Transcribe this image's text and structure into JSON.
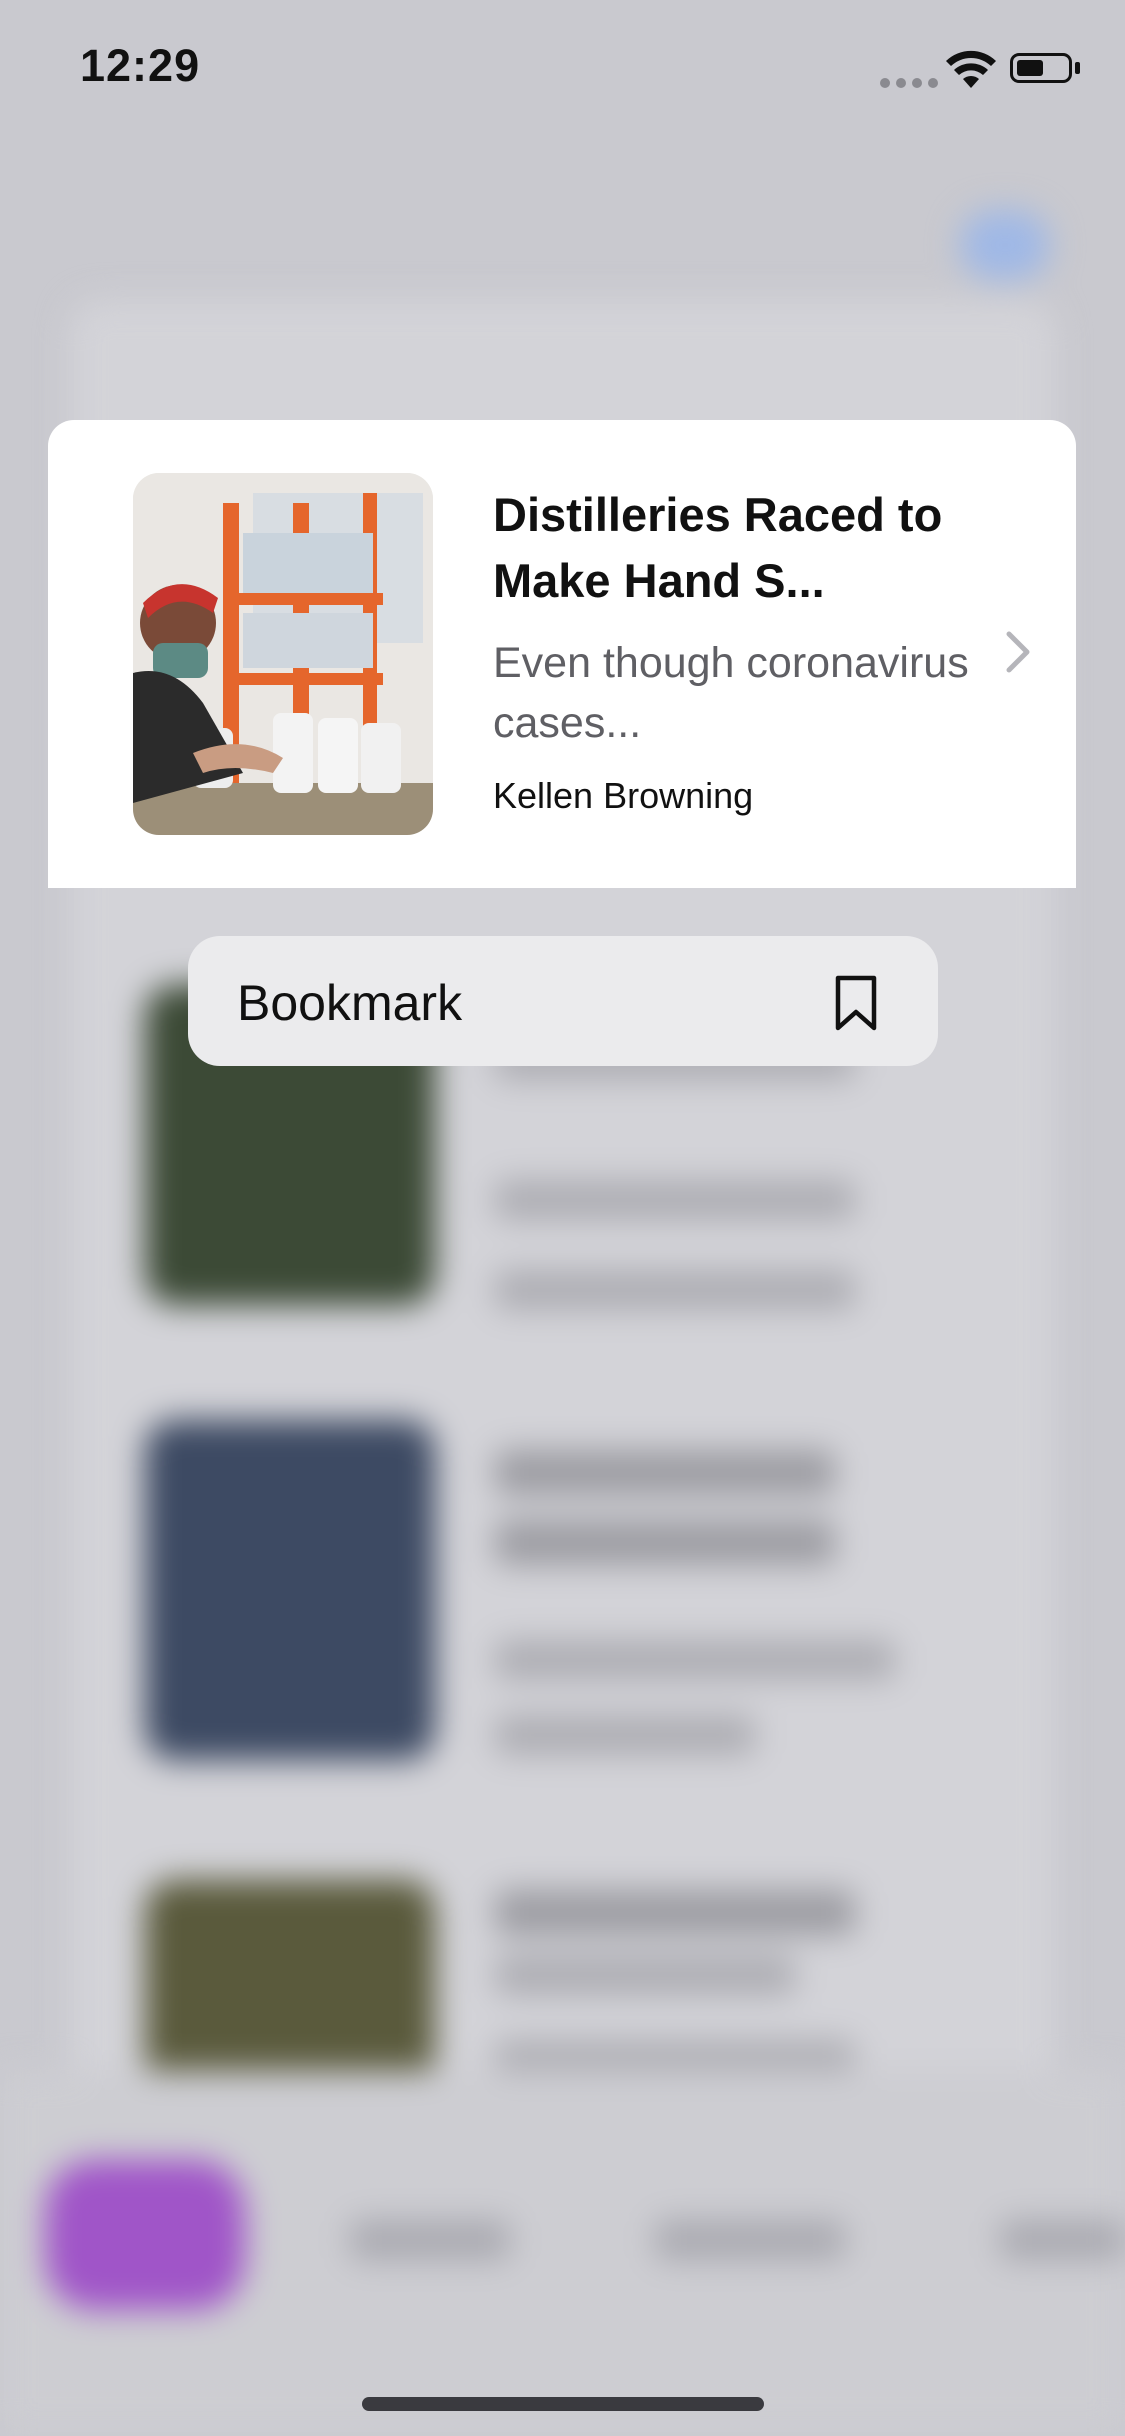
{
  "status_bar": {
    "time": "12:29"
  },
  "article": {
    "headline": "Distilleries Raced to Make Hand S...",
    "summary": "Even though coronavirus cases...",
    "author": "Kellen Browning"
  },
  "context_menu": {
    "items": [
      {
        "label": "Bookmark",
        "icon": "bookmark-icon"
      }
    ]
  },
  "colors": {
    "dim_background": "#c9c9cf",
    "card": "#ffffff",
    "menu": "#ebebed",
    "tab_accent": "#a055c8"
  }
}
